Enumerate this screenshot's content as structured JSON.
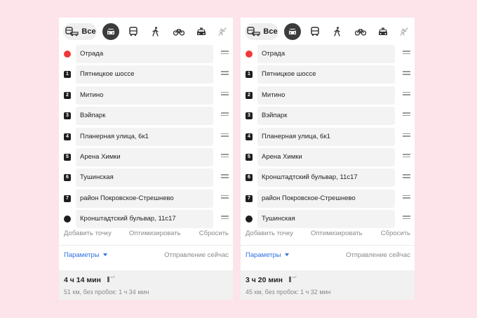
{
  "modes": {
    "all_label": "Все"
  },
  "panels": [
    {
      "stops": [
        {
          "label": "Отрада",
          "marker": "start-dot",
          "marker_text": ""
        },
        {
          "label": "Пятницкое шоссе",
          "marker": "number",
          "marker_text": "1"
        },
        {
          "label": "Митино",
          "marker": "number",
          "marker_text": "2"
        },
        {
          "label": "Вэйпарк",
          "marker": "number",
          "marker_text": "3"
        },
        {
          "label": "Планерная улица, 6к1",
          "marker": "number",
          "marker_text": "4"
        },
        {
          "label": "Арена Химки",
          "marker": "number",
          "marker_text": "5"
        },
        {
          "label": "Тушинская",
          "marker": "number",
          "marker_text": "6"
        },
        {
          "label": "район Покровское-Стрешнево",
          "marker": "number",
          "marker_text": "7"
        },
        {
          "label": "Кронштадтский бульвар, 11с17",
          "marker": "end-dot",
          "marker_text": ""
        }
      ],
      "actions": {
        "add": "Добавить точку",
        "optimize": "Оптимизировать",
        "reset": "Сбросить"
      },
      "params": {
        "label": "Параметры",
        "departure": "Отправление сейчас"
      },
      "summary": {
        "duration": "4 ч 14 мин",
        "details": "51 км, без пробок: 1 ч 34 мин"
      }
    },
    {
      "stops": [
        {
          "label": "Отрада",
          "marker": "start-dot",
          "marker_text": ""
        },
        {
          "label": "Пятницкое шоссе",
          "marker": "number",
          "marker_text": "1"
        },
        {
          "label": "Митино",
          "marker": "number",
          "marker_text": "2"
        },
        {
          "label": "Вэйпарк",
          "marker": "number",
          "marker_text": "3"
        },
        {
          "label": "Планерная улица, 6к1",
          "marker": "number",
          "marker_text": "4"
        },
        {
          "label": "Арена Химки",
          "marker": "number",
          "marker_text": "5"
        },
        {
          "label": "Кронштадтский бульвар, 11с17",
          "marker": "number",
          "marker_text": "6"
        },
        {
          "label": "район Покровское-Стрешнево",
          "marker": "number",
          "marker_text": "7"
        },
        {
          "label": "Тушинская",
          "marker": "end-dot",
          "marker_text": ""
        }
      ],
      "actions": {
        "add": "Добавить точку",
        "optimize": "Оптимизировать",
        "reset": "Сбросить"
      },
      "params": {
        "label": "Параметры",
        "departure": "Отправление сейчас"
      },
      "summary": {
        "duration": "3 ч 20 мин",
        "details": "45 км, без пробок: 1 ч 32 мин"
      }
    }
  ],
  "colors": {
    "start": "#f33737",
    "link": "#2f6fe0",
    "background": "#fce4ea"
  }
}
